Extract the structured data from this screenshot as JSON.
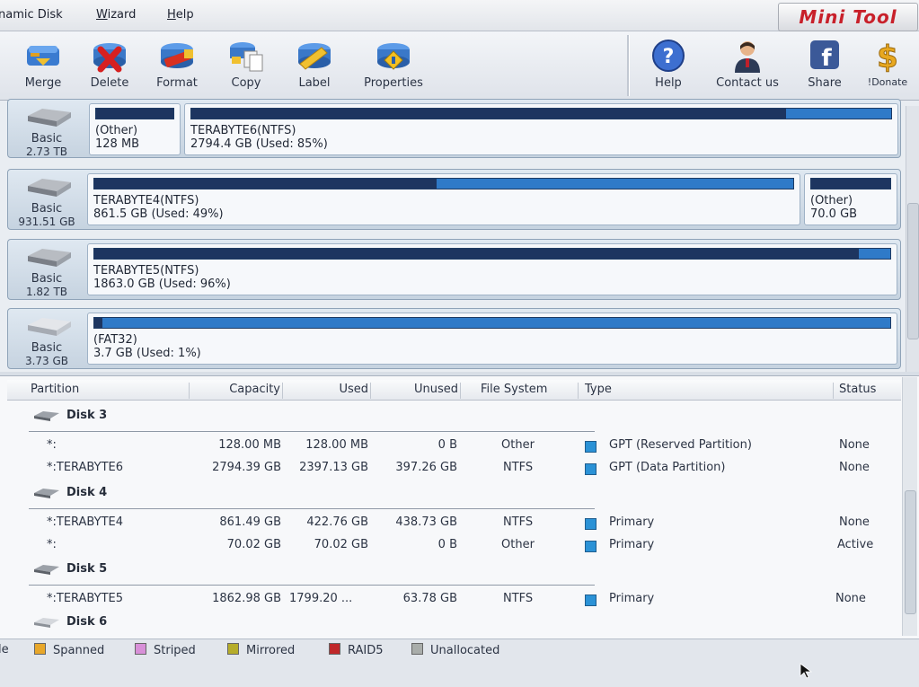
{
  "menu": {
    "items": [
      {
        "label": "namic Disk"
      },
      {
        "label": "Wizard",
        "accel": "W",
        "rest": "izard"
      },
      {
        "label": "Help",
        "accel": "H",
        "rest": "elp"
      }
    ],
    "brand": "Mini Tool"
  },
  "toolbar": {
    "buttons": [
      {
        "label": "Merge",
        "icon": "merge-icon"
      },
      {
        "label": "Delete",
        "icon": "delete-icon"
      },
      {
        "label": "Format",
        "icon": "format-icon"
      },
      {
        "label": "Copy",
        "icon": "copy-icon"
      },
      {
        "label": "Label",
        "icon": "label-icon"
      },
      {
        "label": "Properties",
        "icon": "properties-icon"
      },
      {
        "label": "Help",
        "icon": "help-icon"
      },
      {
        "label": "Contact us",
        "icon": "contact-icon"
      },
      {
        "label": "Share",
        "icon": "facebook-icon"
      },
      {
        "label": "!Donate",
        "icon": "dollar-icon"
      }
    ]
  },
  "disk_map": [
    {
      "type": "Basic",
      "size": "2.73 TB",
      "partitions": [
        {
          "name": "(Other)",
          "info": "128 MB",
          "used": 1.0
        },
        {
          "name": "TERABYTE6(NTFS)",
          "info": "2794.4 GB (Used: 85%)",
          "used": 0.85
        }
      ]
    },
    {
      "type": "Basic",
      "size": "931.51 GB",
      "partitions": [
        {
          "name": "TERABYTE4(NTFS)",
          "info": "861.5 GB (Used: 49%)",
          "used": 0.49
        },
        {
          "name": "(Other)",
          "info": "70.0 GB",
          "used": 1.0
        }
      ]
    },
    {
      "type": "Basic",
      "size": "1.82 TB",
      "partitions": [
        {
          "name": "TERABYTE5(NTFS)",
          "info": "1863.0 GB (Used: 96%)",
          "used": 0.96
        }
      ]
    },
    {
      "type": "Basic",
      "size": "3.73 GB",
      "partitions": [
        {
          "name": "(FAT32)",
          "info": "3.7 GB (Used: 1%)",
          "used": 0.01
        }
      ]
    }
  ],
  "table": {
    "columns": [
      "Partition",
      "Capacity",
      "Used",
      "Unused",
      "File System",
      "Type",
      "Status"
    ],
    "groups": [
      {
        "disk": "Disk 3",
        "rows": [
          {
            "partition": "*:",
            "capacity": "128.00 MB",
            "used": "128.00 MB",
            "unused": "0 B",
            "fs": "Other",
            "type": "GPT (Reserved Partition)",
            "status": "None"
          },
          {
            "partition": "*:TERABYTE6",
            "capacity": "2794.39 GB",
            "used": "2397.13 GB",
            "unused": "397.26 GB",
            "fs": "NTFS",
            "type": "GPT (Data Partition)",
            "status": "None"
          }
        ]
      },
      {
        "disk": "Disk 4",
        "rows": [
          {
            "partition": "*:TERABYTE4",
            "capacity": "861.49 GB",
            "used": "422.76 GB",
            "unused": "438.73 GB",
            "fs": "NTFS",
            "type": "Primary",
            "status": "None"
          },
          {
            "partition": "*:",
            "capacity": "70.02 GB",
            "used": "70.02 GB",
            "unused": "0 B",
            "fs": "Other",
            "type": "Primary",
            "status": "Active"
          }
        ]
      },
      {
        "disk": "Disk 5",
        "rows": [
          {
            "partition": "*:TERABYTE5",
            "capacity": "1862.98 GB",
            "used": "1799.20 ...",
            "unused": "63.78 GB",
            "fs": "NTFS",
            "type": "Primary",
            "status": "None"
          }
        ]
      },
      {
        "disk": "Disk 6",
        "rows": []
      }
    ]
  },
  "legend": [
    {
      "label": "Spanned",
      "color": "#e8a72a"
    },
    {
      "label": "Striped",
      "color": "#d890d8"
    },
    {
      "label": "Mirrored",
      "color": "#b6ad2a"
    },
    {
      "label": "RAID5",
      "color": "#c0282a"
    },
    {
      "label": "Unallocated",
      "color": "#a9adaa"
    }
  ],
  "legend_prefix": "le",
  "colors": {
    "type_primary": "#2b92d6",
    "bar_used": "#1d3560",
    "bar_free": "#2f7ac8"
  }
}
